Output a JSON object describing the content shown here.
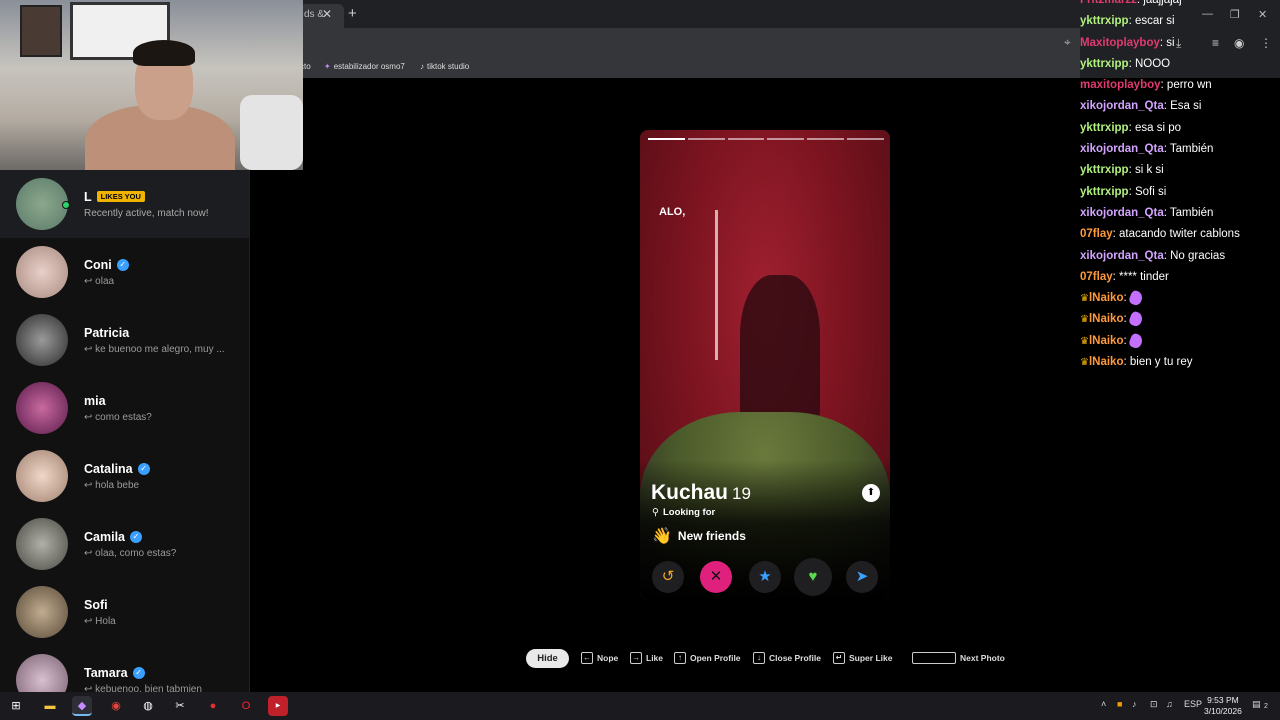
{
  "browser": {
    "tab_label": "ds &",
    "close_glyph": "✕",
    "new_tab_glyph": "+",
    "bookmarks": [
      "cto",
      "estabilizador osmo7",
      "tiktok studio"
    ]
  },
  "sidebar": {
    "items": [
      {
        "name": "L",
        "badge": "LIKES YOU",
        "message": "Recently active, match now!",
        "verified": false,
        "online": true,
        "color": "#6b8a7a"
      },
      {
        "name": "Coni",
        "message": "olaa",
        "verified": true,
        "color": "#d8b8b0"
      },
      {
        "name": "Patricia",
        "message": "ke buenoo me alegro, muy ...",
        "verified": false,
        "color": "#4a4a4a"
      },
      {
        "name": "mia",
        "message": "como estas?",
        "verified": false,
        "color": "#8a3a6a"
      },
      {
        "name": "Catalina",
        "message": "hola bebe",
        "verified": true,
        "color": "#c9a48c"
      },
      {
        "name": "Camila",
        "message": "olaa, como estas?",
        "verified": true,
        "color": "#7a7a72"
      },
      {
        "name": "Sofi",
        "message": "Hola",
        "verified": false,
        "color": "#8c7a62"
      },
      {
        "name": "Tamara",
        "message": "kebuenoo, bien tabmien",
        "verified": true,
        "color": "#b8a0b0"
      }
    ],
    "reply_glyph": "↩"
  },
  "profile": {
    "overlay_text": "ALO,",
    "name": "Kuchau",
    "age": "19",
    "looking_label": "Looking for",
    "goal_icon": "👋",
    "goal": "New friends",
    "photos_total": 6,
    "photo_index": 1
  },
  "actions": {
    "rewind": "↺",
    "nope": "✕",
    "super": "★",
    "like": "♥",
    "boost": "➤"
  },
  "hints": {
    "hide": "Hide",
    "nope": "Nope",
    "like": "Like",
    "open_profile": "Open Profile",
    "close_profile": "Close Profile",
    "super_like": "Super Like",
    "next_photo": "Next Photo",
    "key_left": "←",
    "key_right": "→",
    "key_up": "↑",
    "key_down": "↓",
    "key_enter": "↵"
  },
  "chat": {
    "messages": [
      {
        "user": "Fritzmarzz",
        "text": "jaajjajaj",
        "color": "pink"
      },
      {
        "user": "ykttrxipp",
        "text": "escar si",
        "color": "green"
      },
      {
        "user": "Maxitoplayboy",
        "text": "si",
        "color": "pink"
      },
      {
        "user": "ykttrxipp",
        "text": "NOOO",
        "color": "green"
      },
      {
        "user": "maxitoplayboy",
        "text": "perro wn",
        "color": "pink"
      },
      {
        "user": "xikojordan_Qta",
        "text": "Esa si",
        "color": "purple"
      },
      {
        "user": "ykttrxipp",
        "text": "esa si po",
        "color": "green"
      },
      {
        "user": "xikojordan_Qta",
        "text": "También",
        "color": "purple"
      },
      {
        "user": "ykttrxipp",
        "text": "si k si",
        "color": "green"
      },
      {
        "user": "ykttrxipp",
        "text": "Sofi si",
        "color": "green"
      },
      {
        "user": "xikojordan_Qta",
        "text": "También",
        "color": "purple"
      },
      {
        "user": "07flay",
        "text": "atacando twiter cablons",
        "color": "orange"
      },
      {
        "user": "xikojordan_Qta",
        "text": "No gracias",
        "color": "purple"
      },
      {
        "user": "07flay",
        "text": "**** tinder",
        "color": "orange"
      },
      {
        "user": "lNaiko",
        "text": "",
        "color": "orange",
        "crown": true,
        "emote": true
      },
      {
        "user": "lNaiko",
        "text": "",
        "color": "orange",
        "crown": true,
        "emote": true
      },
      {
        "user": "lNaiko",
        "text": "",
        "color": "orange",
        "crown": true,
        "emote": true
      },
      {
        "user": "lNaiko",
        "text": "bien y tu rey",
        "color": "orange",
        "crown": true
      }
    ]
  },
  "taskbar": {
    "lang": "ESP",
    "time": "9:53 PM",
    "date": "3/10/2026",
    "notifications": "2"
  }
}
